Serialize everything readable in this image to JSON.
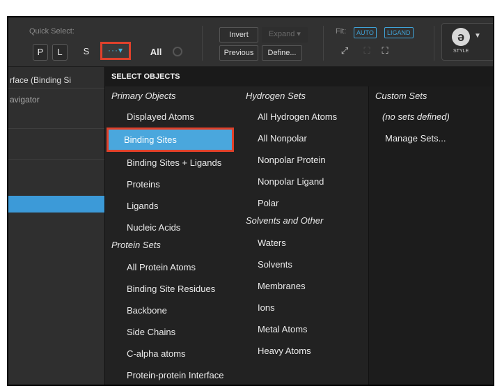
{
  "toolbar": {
    "quick_select_label": "Quick Select:",
    "quick_buttons": [
      "P",
      "L",
      "S"
    ],
    "more_label": "···▾",
    "all_label": "All",
    "invert_label": "Invert",
    "expand_label": "Expand ▾",
    "previous_label": "Previous",
    "define_label": "Define...",
    "fit_label": "Fit:",
    "fit_auto": "AUTO",
    "fit_ligand": "LIGAND",
    "style_label": "STYLE"
  },
  "left_panel": {
    "tab_label": "rface (Binding Si",
    "navigator_label": "avigator"
  },
  "menu": {
    "header": "SELECT OBJECTS",
    "primary_group": "Primary Objects",
    "primary_items": [
      "Displayed Atoms",
      "Binding Sites",
      "Binding Sites + Ligands",
      "Proteins",
      "Ligands",
      "Nucleic Acids"
    ],
    "protein_group": "Protein Sets",
    "protein_items": [
      "All Protein Atoms",
      "Binding Site Residues",
      "Backbone",
      "Side Chains",
      "C-alpha atoms",
      "Protein-protein Interface"
    ],
    "hydrogen_group": "Hydrogen Sets",
    "hydrogen_items": [
      "All Hydrogen Atoms",
      "All Nonpolar",
      "Nonpolar Protein",
      "Nonpolar Ligand",
      "Polar"
    ],
    "solvents_group": "Solvents and Other",
    "solvents_items": [
      "Waters",
      "Solvents",
      "Membranes",
      "Ions",
      "Metal Atoms",
      "Heavy Atoms"
    ],
    "custom_group": "Custom Sets",
    "custom_none": "(no sets defined)",
    "custom_manage": "Manage Sets..."
  },
  "colors": {
    "highlight": "#4aa7dd",
    "callout": "#e0412b",
    "accent": "#3fa3d8"
  }
}
